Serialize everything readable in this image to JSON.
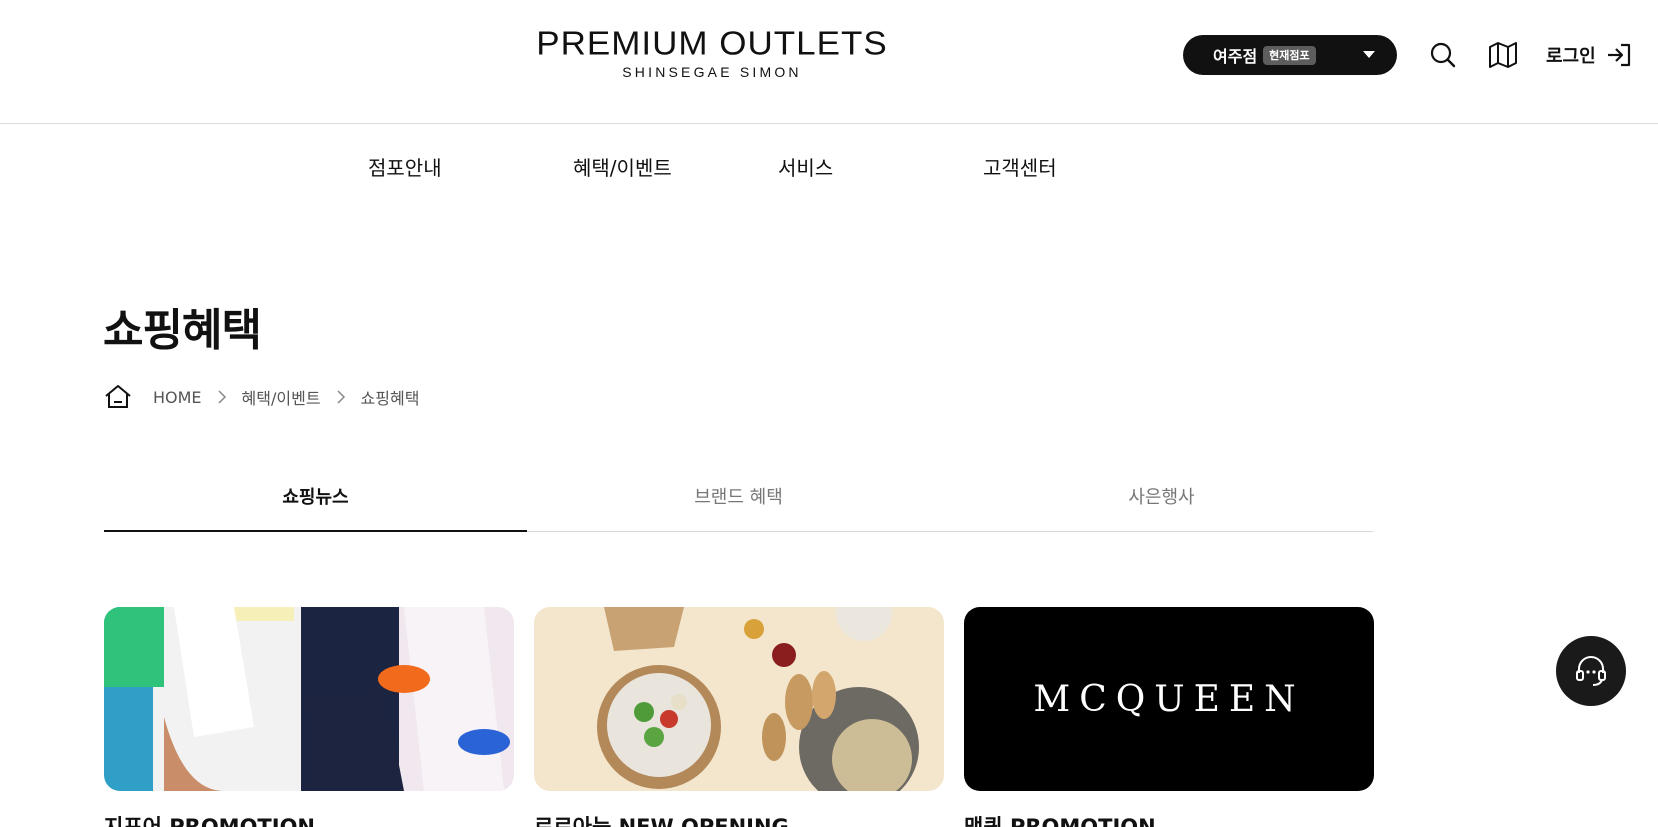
{
  "header": {
    "logo_main": "PREMIUM OUTLETS",
    "logo_sub": "SHINSEGAE SIMON",
    "store": {
      "name": "여주점",
      "badge": "현재점포"
    },
    "login_label": "로그인"
  },
  "gnb": [
    {
      "label": "점포안내"
    },
    {
      "label": "혜택/이벤트"
    },
    {
      "label": "서비스"
    },
    {
      "label": "고객센터"
    }
  ],
  "page": {
    "title": "쇼핑혜택",
    "breadcrumb": [
      "HOME",
      "혜택/이벤트",
      "쇼핑혜택"
    ]
  },
  "tabs": [
    {
      "label": "쇼핑뉴스",
      "active": true
    },
    {
      "label": "브랜드 혜택",
      "active": false
    },
    {
      "label": "사은행사",
      "active": false
    }
  ],
  "cards": [
    {
      "title": "지포어 PROMOTION",
      "image_alt": "golf apparel promotion"
    },
    {
      "title": "로로아늑 NEW OPENING",
      "image_alt": "salad and bread table"
    },
    {
      "title": "맥퀸 PROMOTION",
      "image_logo_text": "MCQUEEN"
    }
  ],
  "colors": {
    "primary": "#111111",
    "badge": "#5d5d5d",
    "border": "#dcdcdc",
    "tab_inactive": "#777777"
  }
}
